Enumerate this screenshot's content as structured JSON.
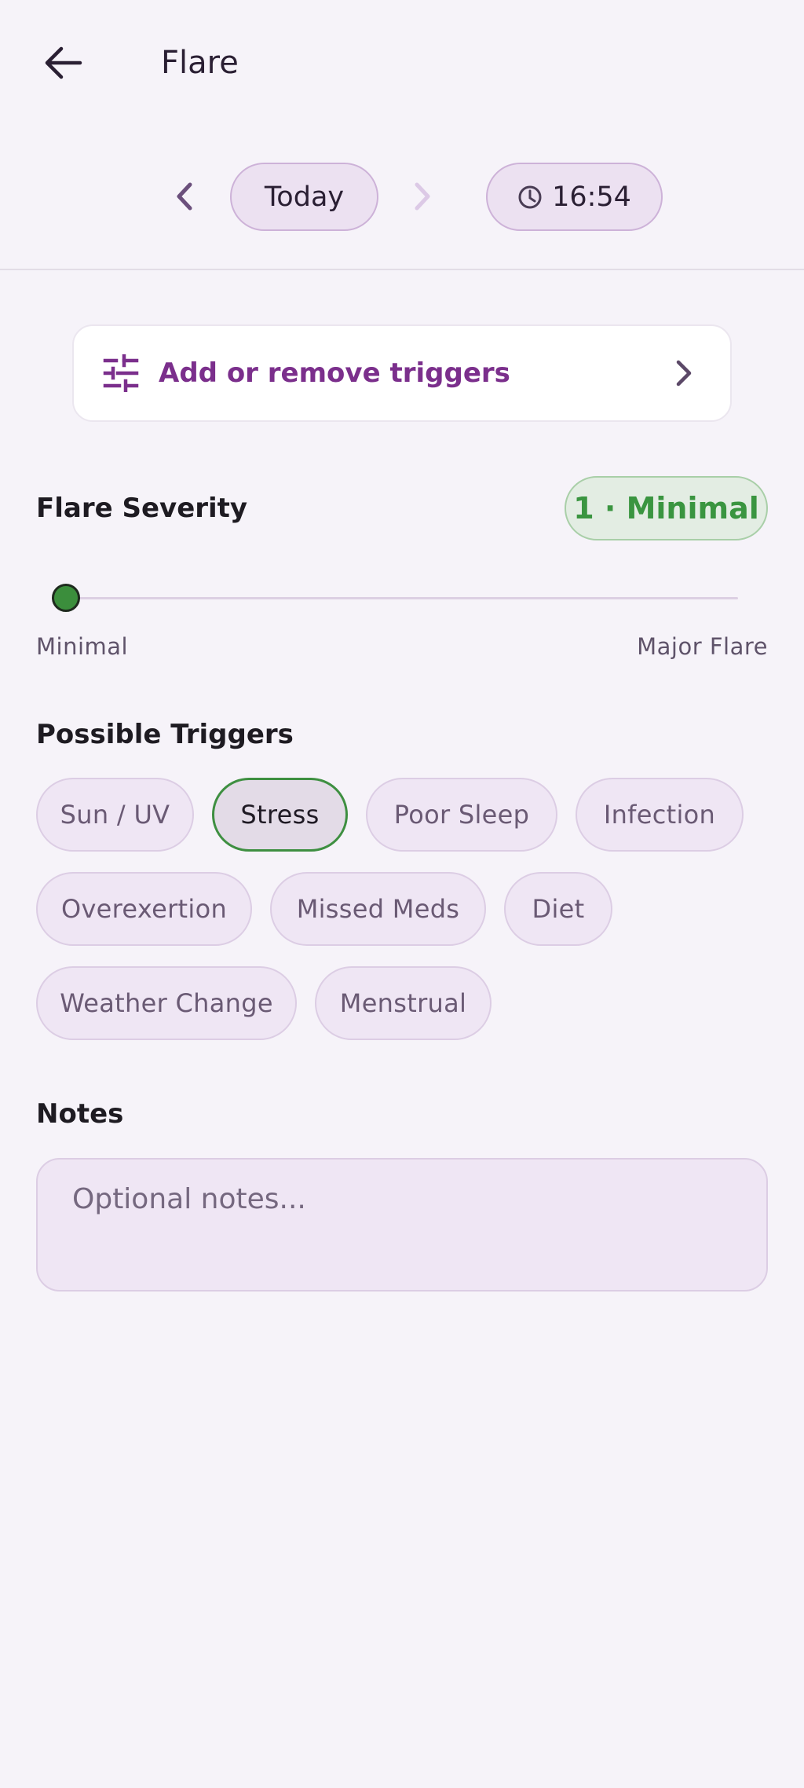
{
  "header": {
    "title": "Flare"
  },
  "date_nav": {
    "day_label": "Today",
    "time_label": "16:54"
  },
  "triggers_card": {
    "label": "Add or remove triggers"
  },
  "severity": {
    "title": "Flare Severity",
    "badge": "1 · Minimal",
    "value": 1,
    "min_label": "Minimal",
    "max_label": "Major Flare"
  },
  "possible_triggers": {
    "title": "Possible Triggers",
    "chips": [
      {
        "label": "Sun / UV",
        "selected": false
      },
      {
        "label": "Stress",
        "selected": true
      },
      {
        "label": "Poor Sleep",
        "selected": false
      },
      {
        "label": "Infection",
        "selected": false
      },
      {
        "label": "Overexertion",
        "selected": false
      },
      {
        "label": "Missed Meds",
        "selected": false
      },
      {
        "label": "Diet",
        "selected": false
      },
      {
        "label": "Weather Change",
        "selected": false
      },
      {
        "label": "Menstrual",
        "selected": false
      }
    ]
  },
  "notes": {
    "title": "Notes",
    "placeholder": "Optional notes...",
    "value": ""
  },
  "colors": {
    "accent": "#7b2f8c",
    "severity_green": "#3a9540",
    "background": "#f6f3f9"
  }
}
